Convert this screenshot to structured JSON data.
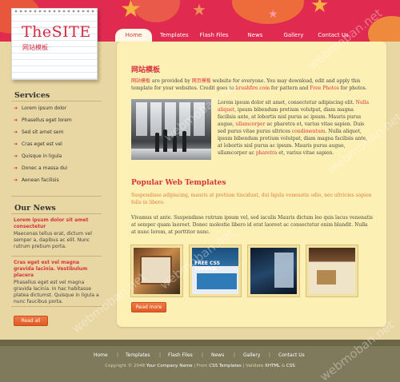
{
  "logo": {
    "title": "TheSITE",
    "subtitle": "网站模板"
  },
  "nav": {
    "items": [
      "Home",
      "Templates",
      "Flash Files",
      "News",
      "Gallery",
      "Contact Us"
    ],
    "active": "Home"
  },
  "sidebar": {
    "services_heading": "Services",
    "services": [
      "Lorem ipsum dolor",
      "Phasellus eget lorem",
      "Sed sit amet sem",
      "Cras eget est vel",
      "Quisque in ligula",
      "Donec a massa dui",
      "Aenean facilisis"
    ],
    "news_heading": "Our News",
    "news": [
      {
        "title": "Lorem ipsum dolor sit amet consectetur",
        "body": "Maecenas tellus erat, dictum vel semper a, dapibus ac elit. Nunc rutrum pretium porta."
      },
      {
        "title": "Cras eget est vel magna gravida lacinia. Vestibulum placera",
        "body": "Phasellus eget est vel magna gravida lacinia. In hac habitasse platea dictumst. Quisque in ligula a nunc faucibus porta."
      }
    ],
    "read_all": "Read all"
  },
  "content": {
    "heading": "网站模板",
    "intro": {
      "part1": "网站模板",
      "part2": " are provided by ",
      "part3": "网页模板",
      "part4": " website for everyone. You may download, edit and apply this template for your websites. Credit goes to ",
      "part5": "brushfire.com",
      "part6": " for pattern and ",
      "part7": "Free Photos",
      "part8": " for photos."
    },
    "photo_text": {
      "p1": "Lorem ipsum dolor sit amet, consectetur adipiscing elit. ",
      "p2": "Nulla aliquet",
      "p3": ", ipsum bibendum pretium volutpat, diam magna facilisis ante, at lobortis nisl purus ac ipsum. Mauris purus augue, ",
      "p4": "ullamcorper",
      "p5": " ac pharetra et, varius vitae sapien. Duis sed purus vitae purus ultrices ",
      "p6": "condimentum",
      "p7": ". Nulla aliquet, ipsum bibendum pretium volutpat, diam magna facilisis ante, at lobortis nisl purus ac ipsum. Mauris purus augue, ullamcorper ac ",
      "p8": "pharetra",
      "p9": " et, varius vitae sapien."
    },
    "popular_heading": "Popular Web Templates",
    "popular_sub": "Suspendisse adipiscing, mauris at pretium tincidunt, dui ligula venenatis odio, nec ultricies sapien felis in libero.",
    "popular_body": "Vivamus ut ante. Suspendisse rutrum ipsum vel, sed iaculis Mauris dictum leo quis lacus venenatis at semper quam laoreet. Donec molestie libero id erat laoreet ac consectetur enim blandit. Nulla at nunc lorem, at porttitor nunc.",
    "thumb2_label": "FREE CSS TEMPLA",
    "read_more": "Read more"
  },
  "footer": {
    "links": [
      "Home",
      "Templates",
      "Flash Files",
      "News",
      "Gallery",
      "Contact Us"
    ],
    "copy_pre": "Copyright © 2048 ",
    "company": "Your Company Name",
    "copy_mid": " | From ",
    "css_templates": "CSS Templates",
    "copy_mid2": " | Validate ",
    "xhtml": "XHTML",
    "amp": " & ",
    "css": "CSS"
  },
  "watermark": "webmoban.net"
}
